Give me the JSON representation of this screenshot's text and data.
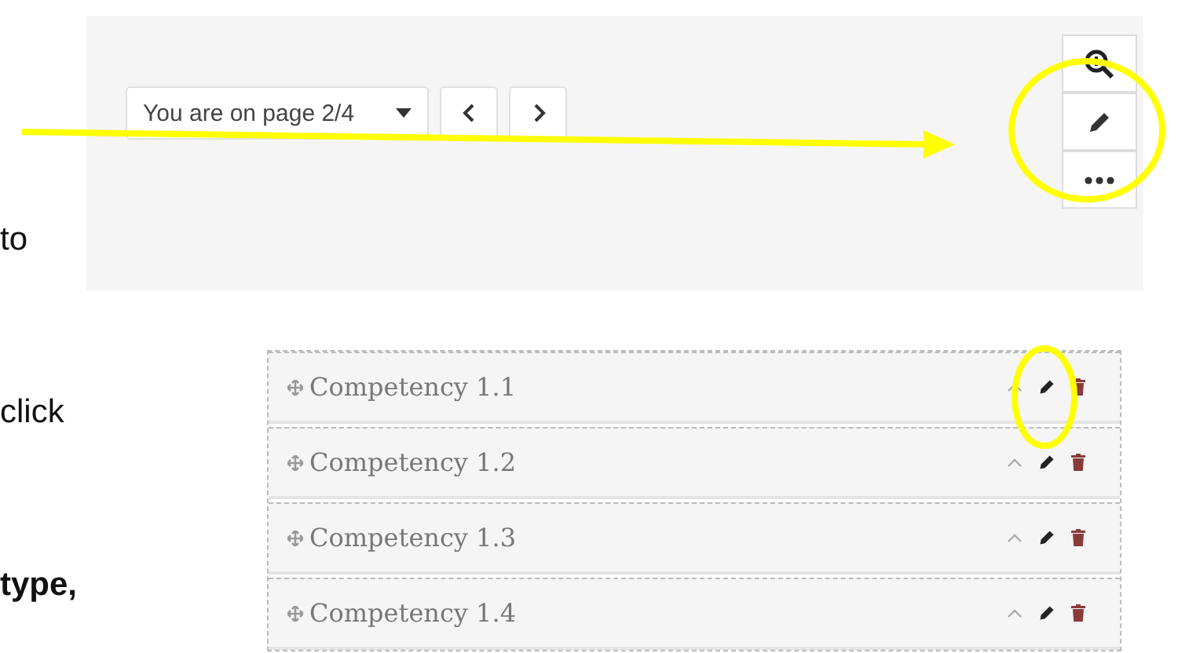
{
  "document_text": [
    {
      "text": "to",
      "bold": false
    },
    {
      "text": "click",
      "bold": false
    },
    {
      "text": "type,",
      "bold": true
    }
  ],
  "toolbar": {
    "page_select": "You are on page 2/4"
  },
  "competencies": [
    {
      "label": "Competency 1.1"
    },
    {
      "label": "Competency 1.2"
    },
    {
      "label": "Competency 1.3"
    },
    {
      "label": "Competency 1.4"
    }
  ]
}
